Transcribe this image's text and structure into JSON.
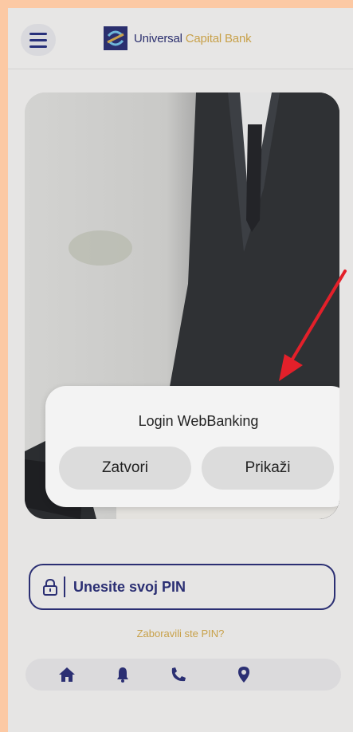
{
  "header": {
    "brand_primary": "Universal",
    "brand_secondary": "Capital Bank",
    "menu_icon": "hamburger-menu-icon",
    "logo_icon": "bank-logo-icon"
  },
  "dialog": {
    "title": "Login WebBanking",
    "close_label": "Zatvori",
    "show_label": "Prikaži"
  },
  "login": {
    "pin_placeholder": "Unesite svoj PIN",
    "forgot_pin": "Zaboravili ste PIN?",
    "lock_icon": "lock-icon"
  },
  "bottom_nav": {
    "items": [
      "home-icon",
      "bell-icon",
      "phone-icon",
      "location-pin-icon"
    ]
  },
  "colors": {
    "brand_navy": "#2b2f73",
    "brand_gold": "#c8a14a",
    "annotation_arrow": "#e3202a",
    "frame": "#fcc9a4"
  }
}
